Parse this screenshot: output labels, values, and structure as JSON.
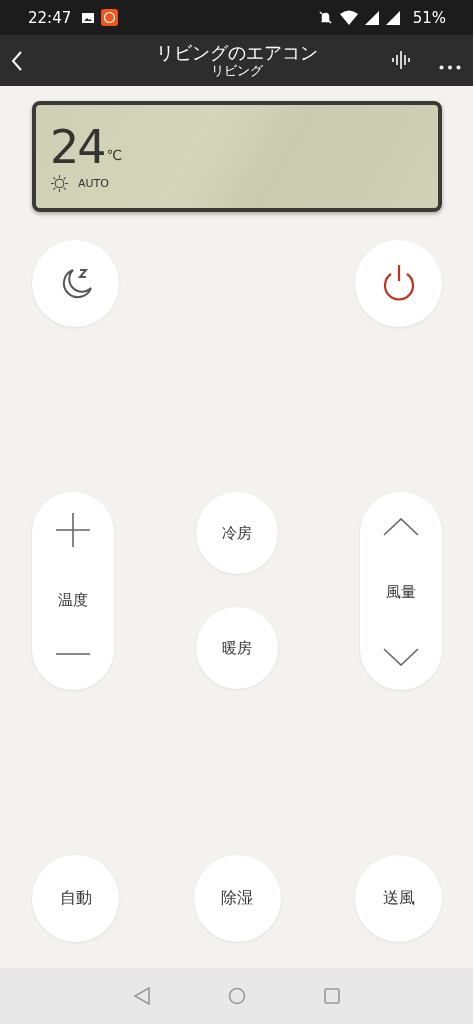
{
  "status_bar": {
    "time": "22:47",
    "battery": "51%"
  },
  "header": {
    "title": "リビングのエアコン",
    "subtitle": "リビング"
  },
  "display": {
    "temperature": "24",
    "unit": "℃",
    "mode": "AUTO"
  },
  "temperature_control": {
    "label": "温度"
  },
  "fan_control": {
    "label": "風量"
  },
  "mode_buttons": [
    {
      "label": "冷房"
    },
    {
      "label": "暖房"
    }
  ],
  "bottom_buttons": [
    {
      "label": "自動"
    },
    {
      "label": "除湿"
    },
    {
      "label": "送風"
    }
  ]
}
